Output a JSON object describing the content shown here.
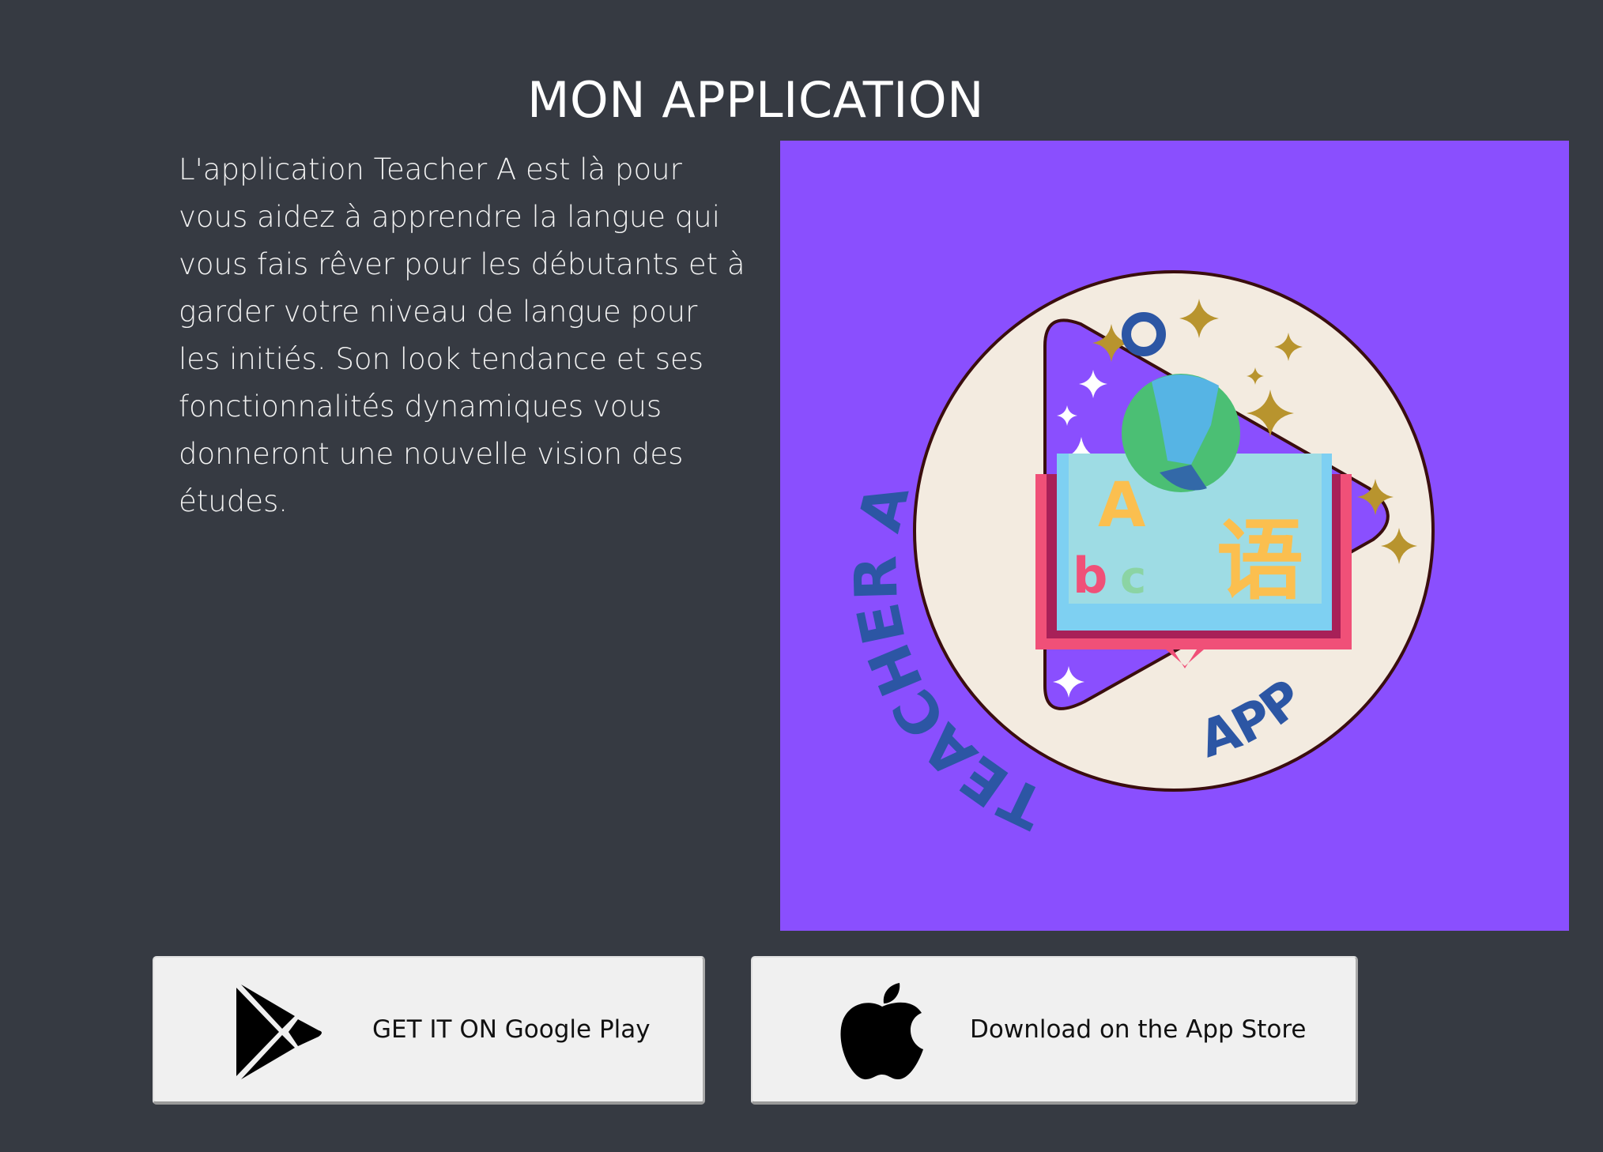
{
  "section": {
    "title": "MON APPLICATION",
    "description": "L'application Teacher A est là pour vous aidez à apprendre la langue qui vous fais rêver pour les débutants et à garder votre niveau de langue pour les initiés. Son look tendance et ses fonctionnalités dynamiques vous donneront une nouvelle vision des études."
  },
  "logo": {
    "text_arc": "TEACHER A",
    "text_bottom": "APP",
    "text_top": "O",
    "background_color": "#8a4ffe",
    "badge_color": "#f3ebe0",
    "letter_color": "#2c56a4",
    "sparkle_color": "#b8942e"
  },
  "buttons": {
    "google_play": {
      "label": "GET IT ON Google Play",
      "icon": "google-play-icon"
    },
    "app_store": {
      "label": "Download on the App Store",
      "icon": "apple-icon"
    }
  }
}
